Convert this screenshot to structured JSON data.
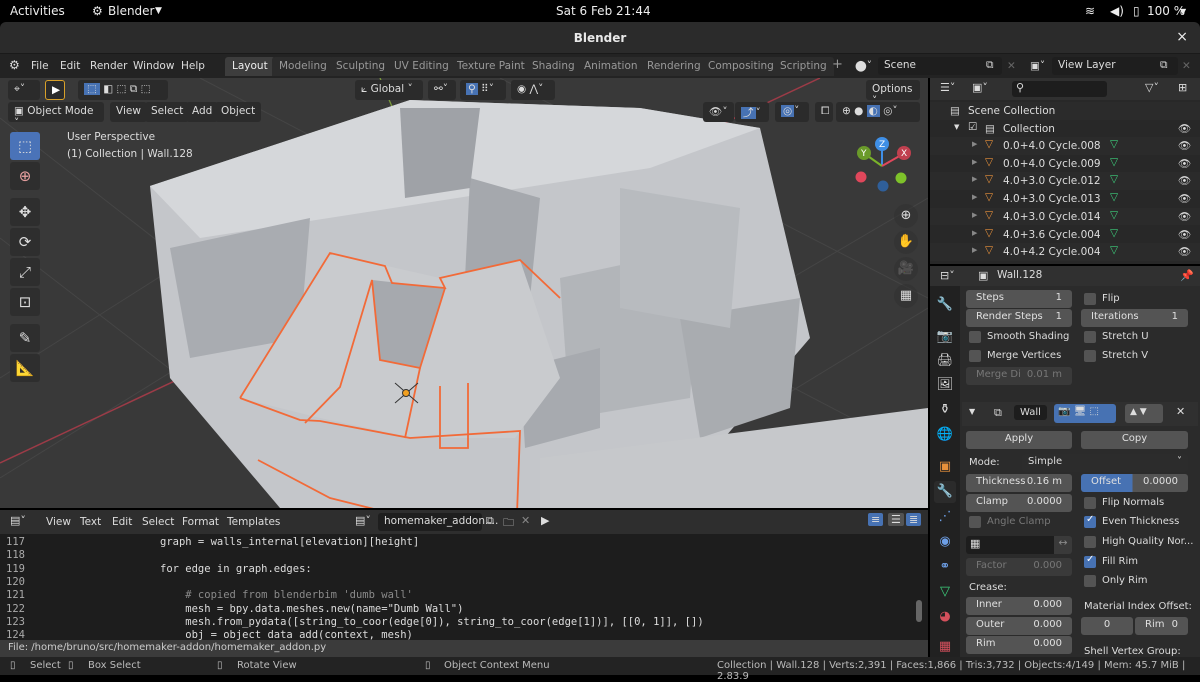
{
  "topbar": {
    "activities": "Activities",
    "app": "Blender",
    "clock": "Sat 6 Feb  21:44",
    "battery": "100 %"
  },
  "window": {
    "title": "Blender",
    "close": "×"
  },
  "menu": {
    "items": [
      "File",
      "Edit",
      "Render",
      "Window",
      "Help"
    ]
  },
  "workspaces": [
    "Layout",
    "Modeling",
    "Sculpting",
    "UV Editing",
    "Texture Paint",
    "Shading",
    "Animation",
    "Rendering",
    "Compositing",
    "Scripting"
  ],
  "scene": {
    "name": "Scene",
    "view_layer": "View Layer"
  },
  "viewport": {
    "mode": "Object Mode",
    "menus": [
      "View",
      "Select",
      "Add",
      "Object"
    ],
    "transform_orientation": "Global",
    "options": "Options",
    "overlay_title": "User Perspective",
    "overlay_subtitle": "(1) Collection | Wall.128",
    "gizmo": {
      "x": "X",
      "y": "Y",
      "z": "Z",
      "x_color": "#e0475b",
      "y_color": "#7ab32a",
      "z_color": "#3f8fe6"
    },
    "selection_color": "#f26a38"
  },
  "outliner": {
    "search_placeholder": "",
    "scene_collection": "Scene Collection",
    "collection": "Collection",
    "items": [
      "0.0+4.0 Cycle.008",
      "0.0+4.0 Cycle.009",
      "4.0+3.0 Cycle.012",
      "4.0+3.0 Cycle.013",
      "4.0+3.0 Cycle.014",
      "4.0+3.6 Cycle.004",
      "4.0+4.2 Cycle.004"
    ]
  },
  "properties": {
    "object_name": "Wall.128",
    "subdiv": {
      "steps_label": "Steps",
      "steps": "1",
      "render_steps_label": "Render Steps",
      "render_steps": "1",
      "iterations_label": "Iterations",
      "iterations": "1",
      "flip": "Flip",
      "smooth_shading": "Smooth Shading",
      "stretch_u": "Stretch U",
      "merge_vertices": "Merge Vertices",
      "stretch_v": "Stretch V",
      "merge_dist_label": "Merge Di",
      "merge_dist": "0.01 m"
    },
    "modifier": {
      "name": "Wall",
      "apply": "Apply",
      "copy": "Copy",
      "mode_label": "Mode:",
      "mode": "Simple",
      "thickness_label": "Thickness",
      "thickness": "0.16 m",
      "offset_label": "Offset",
      "offset": "0.0000",
      "clamp_label": "Clamp",
      "clamp": "0.0000",
      "angle_clamp": "Angle Clamp",
      "flip_normals": "Flip Normals",
      "even_thickness": "Even Thickness",
      "high_quality": "High Quality Nor...",
      "fill_rim": "Fill Rim",
      "only_rim": "Only Rim",
      "factor_label": "Factor",
      "factor": "0.000",
      "crease_label": "Crease:",
      "inner_label": "Inner",
      "inner": "0.000",
      "outer_label": "Outer",
      "outer": "0.000",
      "rim_label": "Rim",
      "rim": "0.000",
      "material_offset_label": "Material Index Offset:",
      "material_offset": "0",
      "material_rim_label": "Rim",
      "material_rim": "0",
      "shell_vg_label": "Shell Vertex Group:"
    }
  },
  "text_editor": {
    "menus": [
      "View",
      "Text",
      "Edit",
      "Select",
      "Format",
      "Templates"
    ],
    "file_name": "homemaker_addon....",
    "lines": [
      {
        "n": "117",
        "code": "graph = walls_internal[elevation][height]"
      },
      {
        "n": "118",
        "code": ""
      },
      {
        "n": "119",
        "code": "for edge in graph.edges:"
      },
      {
        "n": "120",
        "code": ""
      },
      {
        "n": "121",
        "code": "    # copied from blenderbim 'dumb wall'"
      },
      {
        "n": "122",
        "code": "    mesh = bpy.data.meshes.new(name=\"Dumb Wall\")"
      },
      {
        "n": "123",
        "code": "    mesh.from_pydata([string_to_coor(edge[0]), string_to_coor(edge[1])], [[0, 1]], [])"
      },
      {
        "n": "124",
        "code": "    obj = object_data_add(context, mesh)"
      }
    ],
    "file_path": "File: /home/bruno/src/homemaker-addon/homemaker_addon.py"
  },
  "statusbar": {
    "select": "Select",
    "box_select": "Box Select",
    "rotate": "Rotate View",
    "context_menu": "Object Context Menu",
    "stats": "Collection | Wall.128 | Verts:2,391 | Faces:1,866 | Tris:3,732 | Objects:4/149 | Mem: 45.7 MiB | 2.83.9"
  }
}
